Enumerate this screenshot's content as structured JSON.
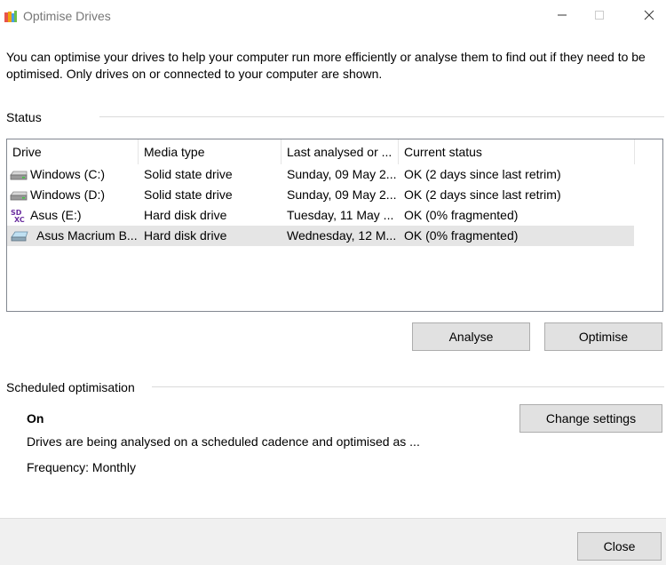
{
  "window": {
    "title": "Optimise Drives",
    "icon": "defrag-app-icon",
    "controls": [
      "minimize-icon",
      "maximize-icon",
      "close-icon"
    ]
  },
  "description": "You can optimise your drives to help your computer run more efficiently or analyse them to find out if they need to be optimised. Only drives on or connected to your computer are shown.",
  "status": {
    "label": "Status",
    "columns": [
      "Drive",
      "Media type",
      "Last analysed or ...",
      "Current status"
    ],
    "drives": [
      {
        "name": "Windows (C:)",
        "media_type": "Solid state drive",
        "last_analysed": "Sunday, 09 May 2...",
        "current_status": "OK (2 days since last retrim)",
        "icon": "ssd-drive-icon",
        "selected": false
      },
      {
        "name": "Windows (D:)",
        "media_type": "Solid state drive",
        "last_analysed": "Sunday, 09 May 2...",
        "current_status": "OK (2 days since last retrim)",
        "icon": "ssd-drive-icon",
        "selected": false
      },
      {
        "name": "Asus (E:)",
        "media_type": "Hard disk drive",
        "last_analysed": "Tuesday, 11 May ...",
        "current_status": "OK (0% fragmented)",
        "icon": "sdxc-card-icon",
        "selected": false
      },
      {
        "name": "Asus Macrium B...",
        "media_type": "Hard disk drive",
        "last_analysed": "Wednesday, 12 M...",
        "current_status": "OK (0% fragmented)",
        "icon": "hdd-drive-icon",
        "selected": true
      }
    ]
  },
  "buttons": {
    "analyse": "Analyse",
    "optimise": "Optimise",
    "change_settings": "Change settings",
    "close": "Close"
  },
  "scheduled": {
    "label": "Scheduled optimisation",
    "state": "On",
    "description": "Drives are being analysed on a scheduled cadence and optimised as ...",
    "frequency": "Frequency: Monthly"
  },
  "colors": {
    "selected_row": "#e5e5e5",
    "button_bg": "#e1e1e1",
    "button_border": "#adadad",
    "footer_bg": "#f0f0f0",
    "sdxc_purple": "#6b2fa0"
  }
}
